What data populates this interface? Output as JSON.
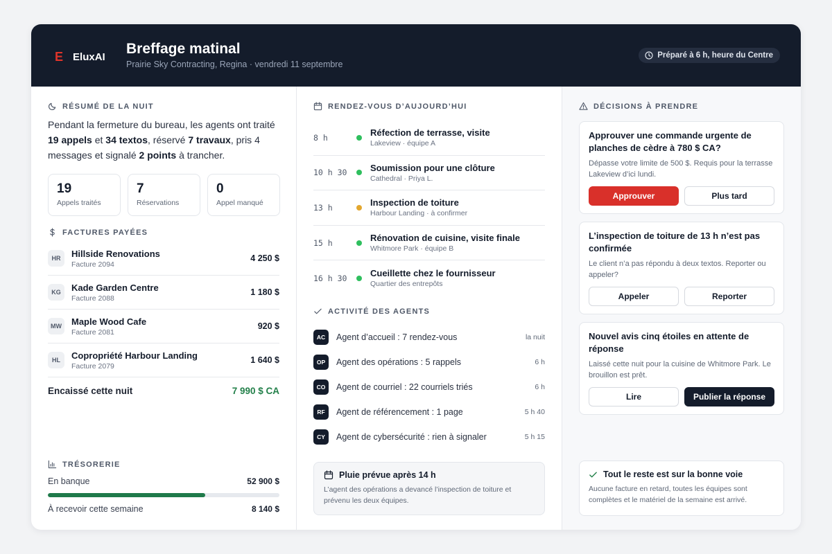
{
  "brand": {
    "mark": "E",
    "name": "EluxAI"
  },
  "header": {
    "title": "Breffage matinal",
    "subtitle": "Prairie Sky Contracting, Regina · vendredi 11 septembre",
    "prepared": "Préparé à 6 h, heure du Centre"
  },
  "summary": {
    "title": "Résumé de la nuit",
    "intro_parts": [
      "Pendant la fermeture du bureau, les agents ont traité ",
      "19 appels",
      " et ",
      "34 textos",
      ", réservé ",
      "7 travaux",
      ", pris 4 messages et signalé ",
      "2 points",
      " à trancher."
    ],
    "stats": [
      {
        "value": "19",
        "label": "Appels traités"
      },
      {
        "value": "7",
        "label": "Réservations"
      },
      {
        "value": "0",
        "label": "Appel manqué"
      }
    ]
  },
  "invoices": {
    "title": "Factures payées",
    "items": [
      {
        "initials": "HR",
        "name": "Hillside Renovations",
        "ref": "Facture 2094",
        "amount": "4 250 $"
      },
      {
        "initials": "KG",
        "name": "Kade Garden Centre",
        "ref": "Facture 2088",
        "amount": "1 180 $"
      },
      {
        "initials": "MW",
        "name": "Maple Wood Cafe",
        "ref": "Facture 2081",
        "amount": "920 $"
      },
      {
        "initials": "HL",
        "name": "Copropriété Harbour Landing",
        "ref": "Facture 2079",
        "amount": "1 640 $"
      }
    ],
    "total_label": "Encaissé cette nuit",
    "total_value": "7 990 $ CA"
  },
  "treasury": {
    "title": "Trésorerie",
    "bank_label": "En banque",
    "bank_value": "52 900 $",
    "bank_fill": 0.68,
    "receivable_label": "À recevoir cette semaine",
    "receivable_value": "8 140 $"
  },
  "appointments": {
    "title": "Rendez-vous d’aujourd’hui",
    "items": [
      {
        "time": "8 h",
        "title": "Réfection de terrasse, visite",
        "sub": "Lakeview · équipe A",
        "status": "green"
      },
      {
        "time": "10 h 30",
        "title": "Soumission pour une clôture",
        "sub": "Cathedral · Priya L.",
        "status": "green"
      },
      {
        "time": "13 h",
        "title": "Inspection de toiture",
        "sub": "Harbour Landing · à confirmer",
        "status": "amber"
      },
      {
        "time": "15 h",
        "title": "Rénovation de cuisine, visite finale",
        "sub": "Whitmore Park · équipe B",
        "status": "green"
      },
      {
        "time": "16 h 30",
        "title": "Cueillette chez le fournisseur",
        "sub": "Quartier des entrepôts",
        "status": "green"
      }
    ]
  },
  "agents": {
    "title": "Activité des agents",
    "items": [
      {
        "initials": "AC",
        "text": "Agent d’accueil : 7 rendez-vous",
        "time": "la nuit"
      },
      {
        "initials": "OP",
        "text": "Agent des opérations : 5 rappels",
        "time": "6 h"
      },
      {
        "initials": "CO",
        "text": "Agent de courriel : 22 courriels triés",
        "time": "6 h"
      },
      {
        "initials": "RF",
        "text": "Agent de référencement : 1 page",
        "time": "5 h 40"
      },
      {
        "initials": "CY",
        "text": "Agent de cybersécurité : rien à signaler",
        "time": "5 h 15"
      }
    ]
  },
  "rain": {
    "title": "Pluie prévue après 14 h",
    "body": "L’agent des opérations a devancé l’inspection de toiture et prévenu les deux équipes."
  },
  "decisions": {
    "title": "Décisions à prendre",
    "cards": [
      {
        "title": "Approuver une commande urgente de planches de cèdre à 780 $ CA?",
        "body": "Dépasse votre limite de 500 $. Requis pour la terrasse Lakeview d’ici lundi.",
        "primary": "Approuver",
        "secondary": "Plus tard"
      },
      {
        "title": "L’inspection de toiture de 13 h n’est pas confirmée",
        "body": "Le client n’a pas répondu à deux textos. Reporter ou appeler?",
        "primary": "Appeler",
        "secondary": "Reporter"
      },
      {
        "title": "Nouvel avis cinq étoiles en attente de réponse",
        "body": "Laissé cette nuit pour la cuisine de Whitmore Park. Le brouillon est prêt.",
        "primary": "Lire",
        "secondary": "Publier la réponse"
      }
    ],
    "ok_title": "Tout le reste est sur la bonne voie",
    "ok_body": "Aucune facture en retard, toutes les équipes sont complètes et le matériel de la semaine est arrivé."
  },
  "colors": {
    "brand_red": "#e0342a",
    "navy": "#141c2b",
    "money_green": "#23804a"
  }
}
